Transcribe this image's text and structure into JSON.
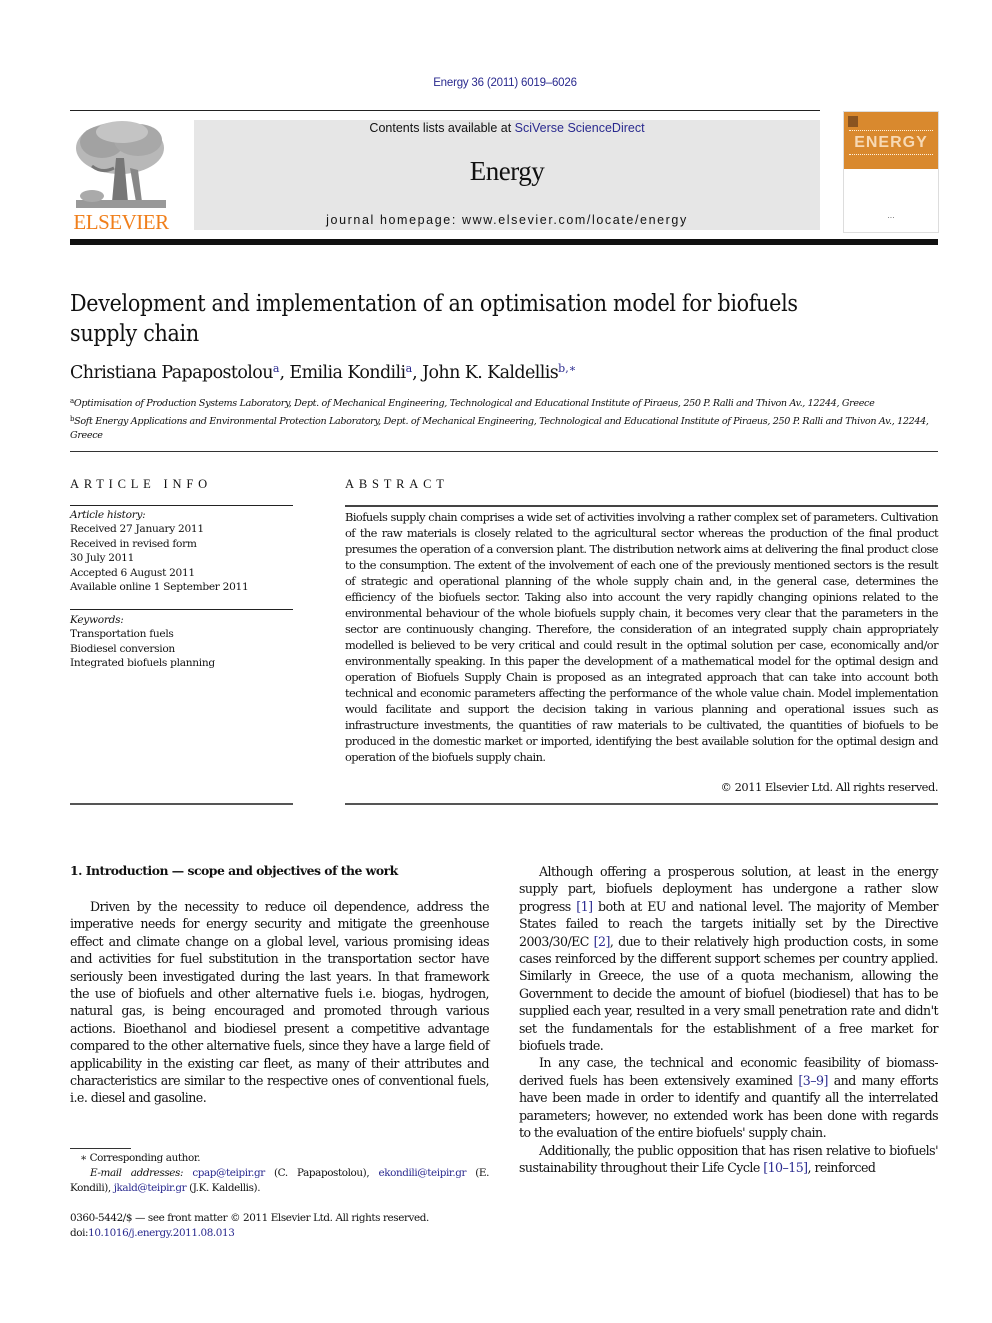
{
  "citation": "Energy 36 (2011) 6019–6026",
  "header": {
    "publisher_logo_text": "ELSEVIER",
    "contents_prefix": "Contents lists available at ",
    "contents_link": "SciVerse ScienceDirect",
    "journal_name": "Energy",
    "homepage_label": "journal homepage: www.elsevier.com/locate/energy",
    "cover_title": "ENERGY",
    "brand_color": "#f07f1b",
    "cover_color": "#d9892e"
  },
  "article": {
    "title_line1": "Development and implementation of an optimisation model for biofuels",
    "title_line2": "supply chain",
    "authors": [
      {
        "name": "Christiana Papapostolou",
        "sup": "a"
      },
      {
        "name": "Emilia Kondili",
        "sup": "a"
      },
      {
        "name": "John K. Kaldellis",
        "sup": "b,∗"
      }
    ],
    "affiliations": [
      {
        "sup": "a",
        "text": "Optimisation of Production Systems Laboratory, Dept. of Mechanical Engineering, Technological and Educational Institute of Piraeus, 250 P. Ralli and Thivon Av., 12244, Greece"
      },
      {
        "sup": "b",
        "text": "Soft Energy Applications and Environmental Protection Laboratory, Dept. of Mechanical Engineering, Technological and Educational Institute of Piraeus, 250 P. Ralli and Thivon Av., 12244, Greece"
      }
    ]
  },
  "article_info": {
    "label": "ARTICLE INFO",
    "history_label": "Article history:",
    "history": [
      "Received 27 January 2011",
      "Received in revised form",
      "30 July 2011",
      "Accepted 6 August 2011",
      "Available online 1 September 2011"
    ],
    "keywords_label": "Keywords:",
    "keywords": [
      "Transportation fuels",
      "Biodiesel conversion",
      "Integrated biofuels planning"
    ]
  },
  "abstract": {
    "label": "ABSTRACT",
    "text": "Biofuels supply chain comprises a wide set of activities involving a rather complex set of parameters. Cultivation of the raw materials is closely related to the agricultural sector whereas the production of the final product presumes the operation of a conversion plant. The distribution network aims at delivering the final product close to the consumption. The extent of the involvement of each one of the previously mentioned sectors is the result of strategic and operational planning of the whole supply chain and, in the general case, determines the efficiency of the biofuels sector. Taking also into account the very rapidly changing opinions related to the environmental behaviour of the whole biofuels supply chain, it becomes very clear that the parameters in the sector are continuously changing. Therefore, the consideration of an integrated supply chain appropriately modelled is believed to be very critical and could result in the optimal solution per case, economically and/or environmentally speaking. In this paper the development of a mathematical model for the optimal design and operation of Biofuels Supply Chain is proposed as an integrated approach that can take into account both technical and economic parameters affecting the performance of the whole value chain. Model implementation would facilitate and support the decision taking in various planning and operational issues such as infrastructure investments, the quantities of raw materials to be cultivated, the quantities of biofuels to be produced in the domestic market or imported, identifying the best available solution for the optimal design and operation of the biofuels supply chain.",
    "copyright": "© 2011 Elsevier Ltd. All rights reserved."
  },
  "body": {
    "section1_heading": "1.  Introduction — scope and objectives of the work",
    "left_paragraph": "Driven by the necessity to reduce oil dependence, address the imperative needs for energy security and mitigate the greenhouse effect and climate change on a global level, various promising ideas and activities for fuel substitution in the transportation sector have seriously been investigated during the last years. In that framework the use of biofuels and other alternative fuels i.e. biogas, hydrogen, natural gas, is being encouraged and promoted through various actions. Bioethanol and biodiesel present a competitive advantage compared to the other alternative fuels, since they have a large field of applicability in the existing car fleet, as many of their attributes and characteristics are similar to the respective ones of conventional fuels, i.e. diesel and gasoline.",
    "right_p1": {
      "a": "Although offering a prosperous solution, at least in the energy supply part, biofuels deployment has undergone a rather slow progress ",
      "ref1": "[1]",
      "b": " both at EU and national level. The majority of Member States failed to reach the targets initially set by the Directive 2003/30/EC ",
      "ref2": "[2]",
      "c": ", due to their relatively high production costs, in some cases reinforced by the different support schemes per country applied. Similarly in Greece, the use of a quota mechanism, allowing the Government to decide the amount of biofuel (biodiesel) that has to be supplied each year, resulted in a very small penetration rate and didn't set the fundamentals for the establishment of a free market for biofuels trade."
    },
    "right_p2": {
      "a": "In any case, the technical and economic feasibility of biomass-derived fuels has been extensively examined ",
      "ref": "[3–9]",
      "b": " and many efforts have been made in order to identify and quantify all the interrelated parameters; however, no extended work has been done with regards to the evaluation of the entire biofuels' supply chain."
    },
    "right_p3": {
      "a": "Additionally, the public opposition that has risen relative to biofuels' sustainability throughout their Life Cycle ",
      "ref": "[10–15]",
      "b": ", reinforced"
    }
  },
  "footnotes": {
    "corresponding": "∗  Corresponding author.",
    "email_label": "E-mail addresses:",
    "emails": [
      {
        "email": "cpap@teipir.gr",
        "who": " (C. Papapostolou), "
      },
      {
        "email": "ekondili@teipir.gr",
        "who": " (E. Kondili), "
      },
      {
        "email": "jkald@teipir.gr",
        "who": " (J.K. Kaldellis)."
      }
    ],
    "front_matter": "0360-5442/$ — see front matter © 2011 Elsevier Ltd. All rights reserved.",
    "doi_label": "doi:",
    "doi": "10.1016/j.energy.2011.08.013"
  }
}
